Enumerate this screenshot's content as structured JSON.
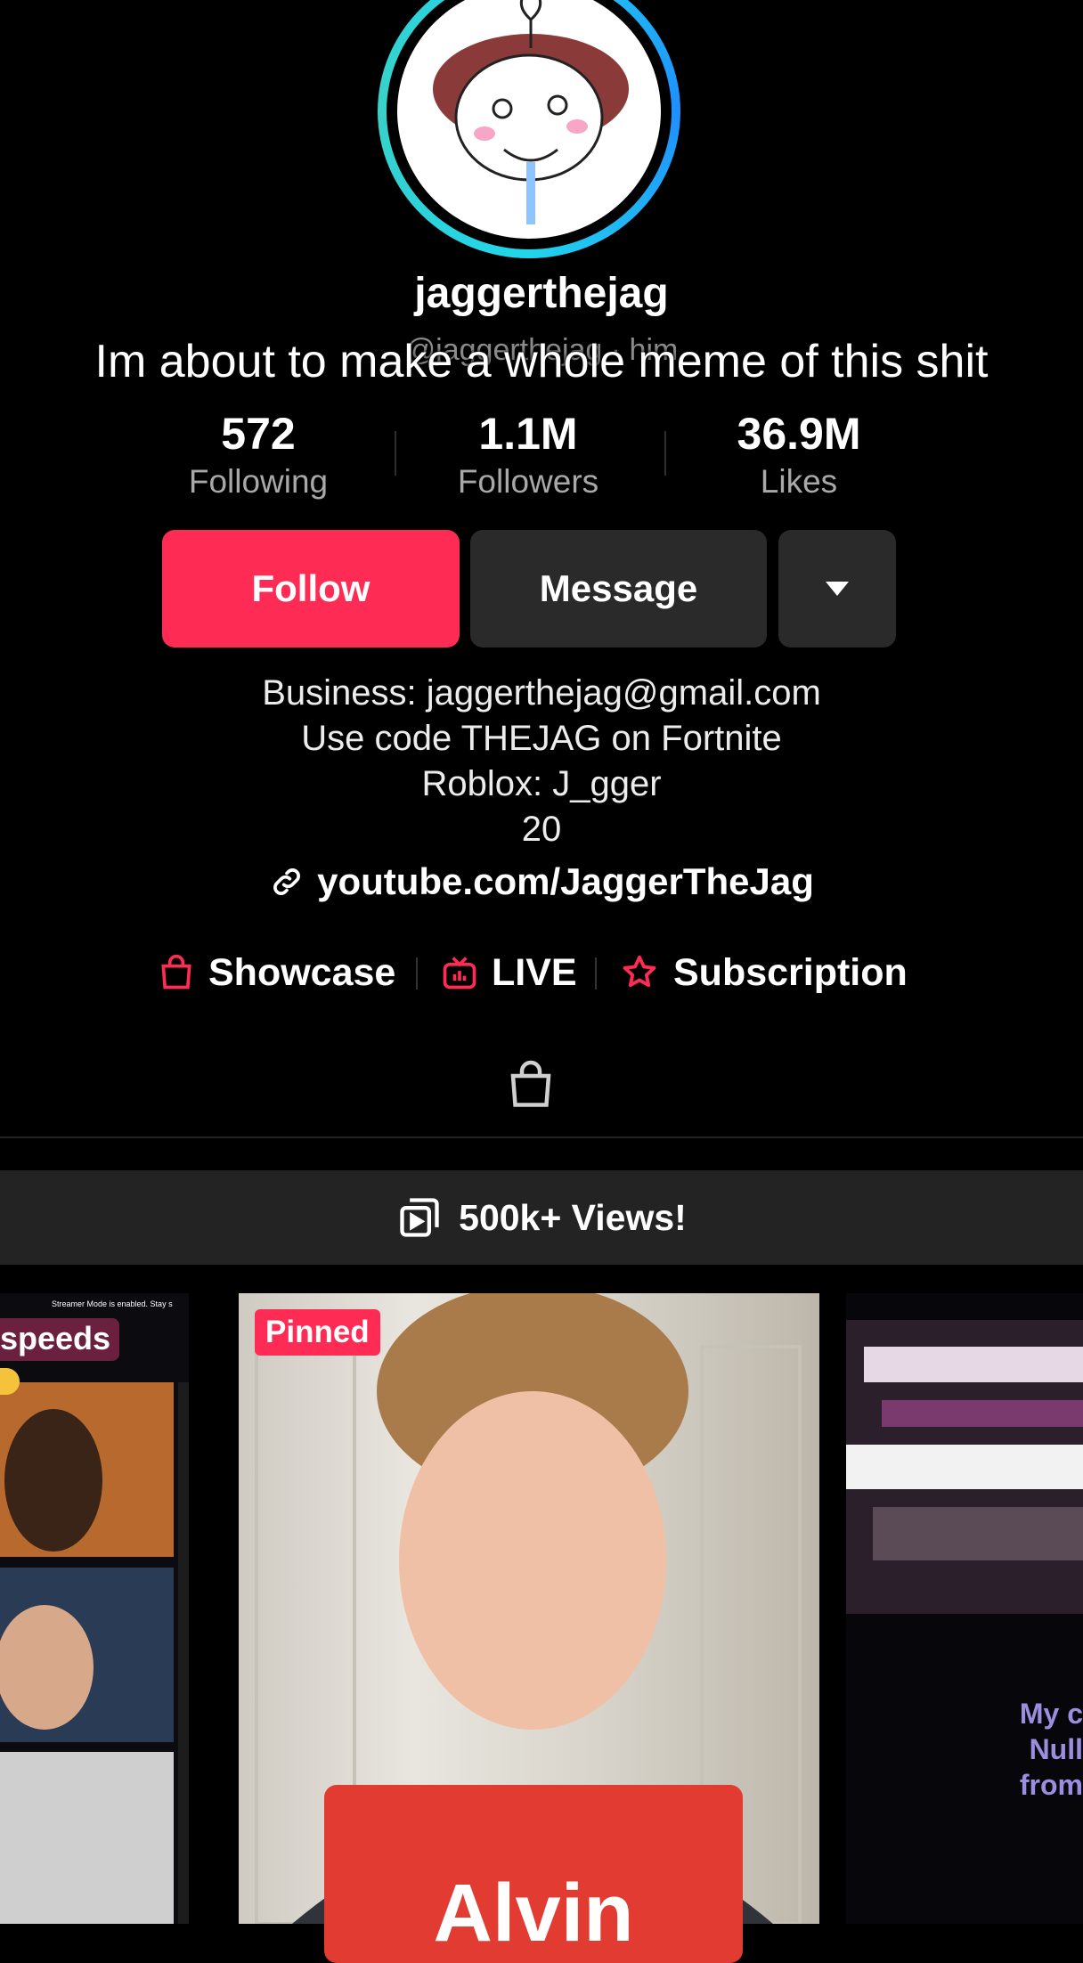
{
  "profile": {
    "username": "jaggerthejag",
    "handle": "@jaggerthejag · him",
    "caption_overlay": "Im about to make a whole meme of this shit"
  },
  "stats": [
    {
      "value": "572",
      "label": "Following"
    },
    {
      "value": "1.1M",
      "label": "Followers"
    },
    {
      "value": "36.9M",
      "label": "Likes"
    }
  ],
  "actions": {
    "follow": "Follow",
    "message": "Message",
    "more_icon": "caret-down-icon"
  },
  "bio": {
    "lines": [
      "Business: jaggerthejag@gmail.com",
      "Use code THEJAG on Fortnite",
      "Roblox: J_gger",
      "20"
    ],
    "link": "youtube.com/JaggerTheJag"
  },
  "features": [
    {
      "label": "Showcase",
      "icon": "shopping-bag-icon"
    },
    {
      "label": "LIVE",
      "icon": "live-tv-icon"
    },
    {
      "label": "Subscription",
      "icon": "subscription-star-icon"
    }
  ],
  "tabs": {
    "shop_icon": "shop-bag-icon"
  },
  "playlist": {
    "label": "500k+ Views!",
    "icon": "playlist-icon"
  },
  "videos": {
    "left": {
      "overlay": "speeds",
      "banner": "Streamer Mode is enabled. Stay s"
    },
    "main": {
      "badge": "Pinned",
      "sign_text": "Alvin"
    },
    "right": {
      "lines": [
        "My c",
        "Null",
        "from"
      ]
    }
  },
  "colors": {
    "accent": "#fe2c55",
    "button_dark": "#2a2a2a",
    "background": "#000000"
  }
}
